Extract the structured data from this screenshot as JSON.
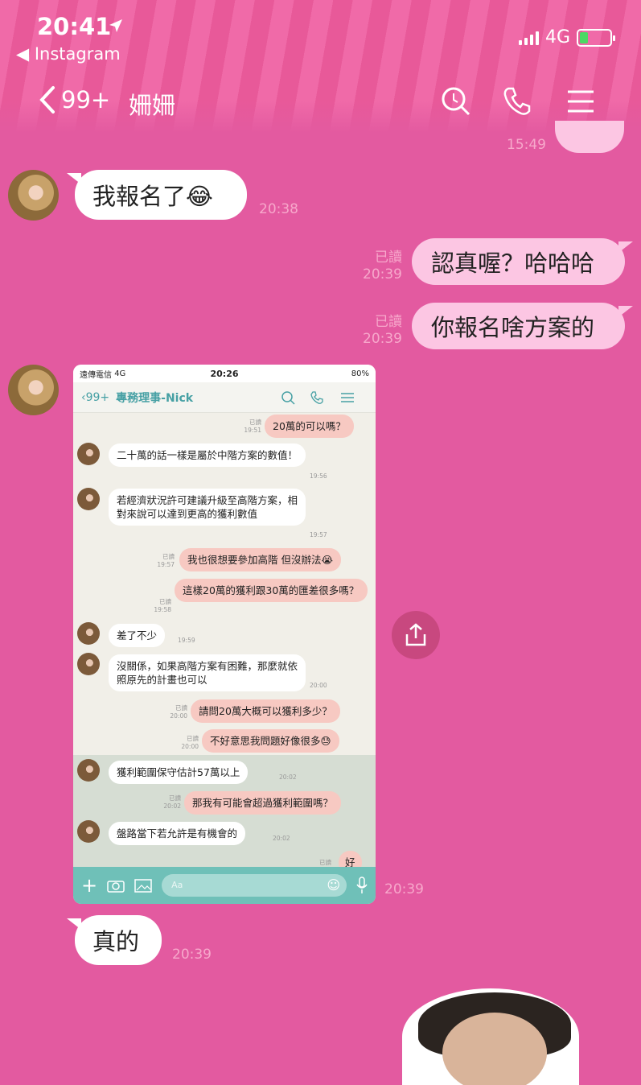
{
  "status_bar": {
    "time": "20:41",
    "back_app": "Instagram",
    "network": "4G"
  },
  "nav": {
    "unread": "99+",
    "title": "姍姍"
  },
  "colors": {
    "background": "#e35aa0",
    "outgoing_bubble": "#fcc6e3",
    "incoming_bubble": "#ffffff"
  },
  "messages": {
    "top_time": "15:49",
    "m1": {
      "text": "我報名了😂",
      "time": "20:38"
    },
    "m2": {
      "text": "認真喔？哈哈哈",
      "read": "已讀",
      "time": "20:39"
    },
    "m3": {
      "text": "你報名啥方案的",
      "read": "已讀",
      "time": "20:39"
    },
    "image_time": "20:39",
    "m4": {
      "text": "真的",
      "time": "20:39"
    }
  },
  "screenshot": {
    "status": {
      "carrier": "遠傳電信",
      "network": "4G",
      "time": "20:26",
      "battery": "80%"
    },
    "nav": {
      "back": "99+",
      "title": "專務理事-Nick"
    },
    "msgs": [
      {
        "text": "20萬的可以嗎？",
        "read": "已讀",
        "time": "19:51"
      },
      {
        "text": "二十萬的話一樣是屬於中階方案的數值！",
        "time": "19:56"
      },
      {
        "text": "若經濟狀況許可建議升級至高階方案，相對來說可以達到更高的獲利數值",
        "time": "19:57"
      },
      {
        "text": "我也很想要參加高階 但沒辦法😭",
        "read": "已讀",
        "time": "19:57"
      },
      {
        "text": "這樣20萬的獲利跟30萬的匯差很多嗎？",
        "read": "已讀",
        "time": "19:58"
      },
      {
        "text": "差了不少",
        "time": "19:59"
      },
      {
        "text": "沒關係，如果高階方案有困難，那麼就依照原先的計畫也可以",
        "time": "20:00"
      },
      {
        "text": "請問20萬大概可以獲利多少？",
        "read": "已讀",
        "time": "20:00"
      },
      {
        "text": "不好意思我問題好像很多😓",
        "read": "已讀",
        "time": "20:00"
      },
      {
        "text": "獲利範圍保守估計57萬以上",
        "time": "20:02"
      },
      {
        "text": "那我有可能會超過獲利範圍嗎？",
        "read": "已讀",
        "time": "20:02"
      },
      {
        "text": "盤路當下若允許是有機會的",
        "time": "20:02"
      },
      {
        "text": "好",
        "read": "已讀"
      }
    ],
    "input_placeholder": "Aa"
  }
}
